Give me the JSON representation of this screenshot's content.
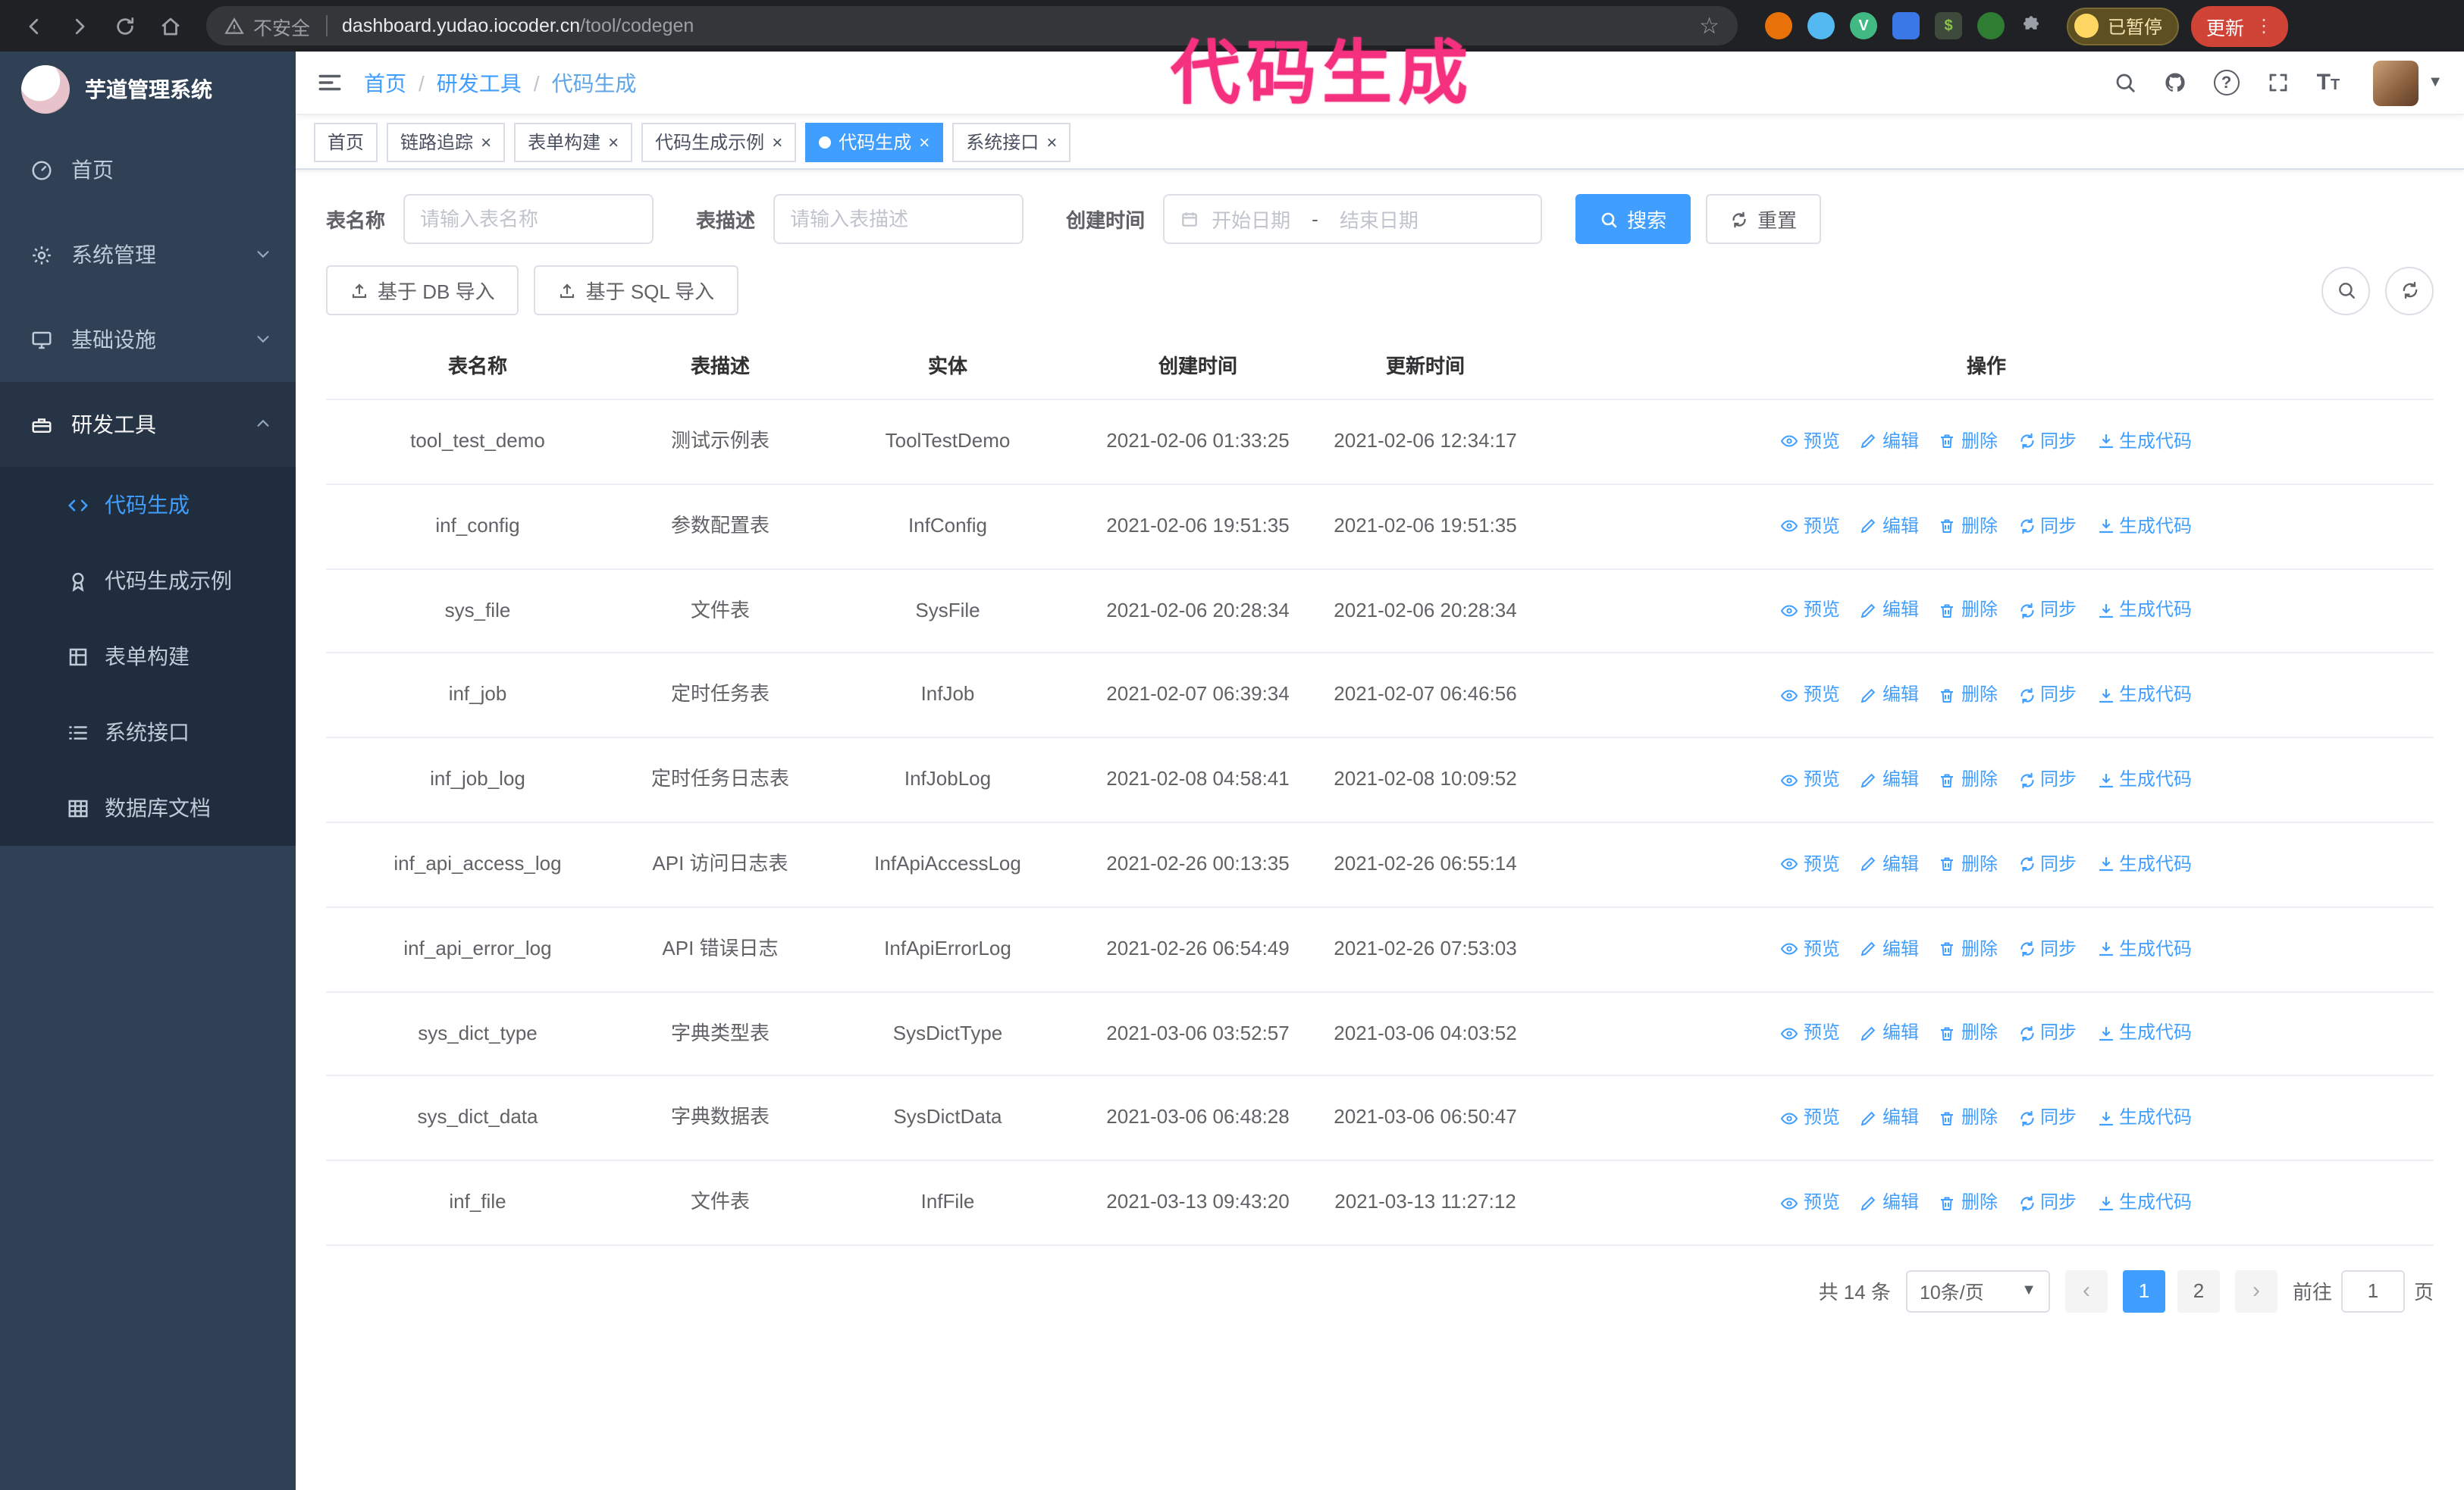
{
  "annotation": {
    "text": "代码生成"
  },
  "browser": {
    "security_label": "不安全",
    "url_domain": "dashboard.yudao.iocoder.cn",
    "url_path": "/tool/codegen",
    "paused_badge": "已暂停",
    "update_button": "更新"
  },
  "sidebar": {
    "app_title": "芋道管理系统",
    "items": [
      {
        "label": "首页"
      },
      {
        "label": "系统管理"
      },
      {
        "label": "基础设施"
      },
      {
        "label": "研发工具"
      }
    ],
    "subitems": [
      {
        "label": "代码生成"
      },
      {
        "label": "代码生成示例"
      },
      {
        "label": "表单构建"
      },
      {
        "label": "系统接口"
      },
      {
        "label": "数据库文档"
      }
    ]
  },
  "header": {
    "breadcrumb": [
      "首页",
      "研发工具",
      "代码生成"
    ],
    "separator": "/"
  },
  "tabs": [
    {
      "label": "首页",
      "closable": false,
      "active": false
    },
    {
      "label": "链路追踪",
      "closable": true,
      "active": false
    },
    {
      "label": "表单构建",
      "closable": true,
      "active": false
    },
    {
      "label": "代码生成示例",
      "closable": true,
      "active": false
    },
    {
      "label": "代码生成",
      "closable": true,
      "active": true
    },
    {
      "label": "系统接口",
      "closable": true,
      "active": false
    }
  ],
  "filters": {
    "table_name_label": "表名称",
    "table_name_placeholder": "请输入表名称",
    "table_desc_label": "表描述",
    "table_desc_placeholder": "请输入表描述",
    "create_time_label": "创建时间",
    "date_start_placeholder": "开始日期",
    "date_separator": "-",
    "date_end_placeholder": "结束日期",
    "search_button": "搜索",
    "reset_button": "重置",
    "import_db_button": "基于 DB 导入",
    "import_sql_button": "基于 SQL 导入"
  },
  "table": {
    "columns": [
      "表名称",
      "表描述",
      "实体",
      "创建时间",
      "更新时间",
      "操作"
    ],
    "actions": [
      "预览",
      "编辑",
      "删除",
      "同步",
      "生成代码"
    ],
    "rows": [
      {
        "name": "tool_test_demo",
        "desc": "测试示例表",
        "entity": "ToolTestDemo",
        "created": "2021-02-06 01:33:25",
        "updated": "2021-02-06 12:34:17"
      },
      {
        "name": "inf_config",
        "desc": "参数配置表",
        "entity": "InfConfig",
        "created": "2021-02-06 19:51:35",
        "updated": "2021-02-06 19:51:35"
      },
      {
        "name": "sys_file",
        "desc": "文件表",
        "entity": "SysFile",
        "created": "2021-02-06 20:28:34",
        "updated": "2021-02-06 20:28:34"
      },
      {
        "name": "inf_job",
        "desc": "定时任务表",
        "entity": "InfJob",
        "created": "2021-02-07 06:39:34",
        "updated": "2021-02-07 06:46:56"
      },
      {
        "name": "inf_job_log",
        "desc": "定时任务日志表",
        "entity": "InfJobLog",
        "created": "2021-02-08 04:58:41",
        "updated": "2021-02-08 10:09:52"
      },
      {
        "name": "inf_api_access_log",
        "desc": "API 访问日志表",
        "entity": "InfApiAccessLog",
        "created": "2021-02-26 00:13:35",
        "updated": "2021-02-26 06:55:14"
      },
      {
        "name": "inf_api_error_log",
        "desc": "API 错误日志",
        "entity": "InfApiErrorLog",
        "created": "2021-02-26 06:54:49",
        "updated": "2021-02-26 07:53:03"
      },
      {
        "name": "sys_dict_type",
        "desc": "字典类型表",
        "entity": "SysDictType",
        "created": "2021-03-06 03:52:57",
        "updated": "2021-03-06 04:03:52"
      },
      {
        "name": "sys_dict_data",
        "desc": "字典数据表",
        "entity": "SysDictData",
        "created": "2021-03-06 06:48:28",
        "updated": "2021-03-06 06:50:47"
      },
      {
        "name": "inf_file",
        "desc": "文件表",
        "entity": "InfFile",
        "created": "2021-03-13 09:43:20",
        "updated": "2021-03-13 11:27:12"
      }
    ]
  },
  "pagination": {
    "total": "共 14 条",
    "page_size": "10条/页",
    "pages": [
      {
        "label": "1",
        "active": true
      },
      {
        "label": "2",
        "active": false
      }
    ],
    "goto_label": "前往",
    "goto_value": "1",
    "goto_suffix": "页"
  },
  "colors": {
    "accent": "#409eff",
    "sidebar_bg": "#304156",
    "submenu_bg": "#1f2d3d",
    "annotation": "#f5317f",
    "chrome_bg": "#202124",
    "update_button_bg": "#cf4436"
  }
}
